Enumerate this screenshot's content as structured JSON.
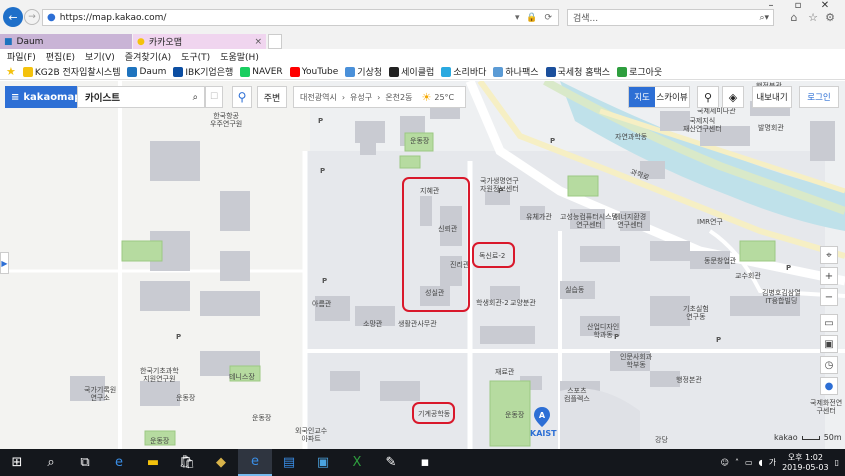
{
  "browser": {
    "url": "https://map.kakao.com/",
    "search_placeholder": "검색...",
    "tabs": [
      {
        "label": "Daum"
      },
      {
        "label": "카카오맵"
      }
    ],
    "menu": [
      "파일(F)",
      "편집(E)",
      "보기(V)",
      "즐겨찾기(A)",
      "도구(T)",
      "도움말(H)"
    ],
    "favorites": [
      {
        "label": "KG2B 전자입찰시스템",
        "color": "#f4c20d"
      },
      {
        "label": "Daum",
        "color": "#1e73be"
      },
      {
        "label": "IBK기업은행",
        "color": "#0c4ea2"
      },
      {
        "label": "NAVER",
        "color": "#19ce60"
      },
      {
        "label": "YouTube",
        "color": "#ff0000"
      },
      {
        "label": "기상청",
        "color": "#4a90d9"
      },
      {
        "label": "세이클럽",
        "color": "#222222"
      },
      {
        "label": "소리바다",
        "color": "#2aa9e0"
      },
      {
        "label": "하나팩스",
        "color": "#5b9bd5"
      },
      {
        "label": "국세청 홈택스",
        "color": "#1b4f9c"
      },
      {
        "label": "로그아웃",
        "color": "#2e9e3e"
      }
    ]
  },
  "map_ui": {
    "brand": "kakaomap",
    "search_value": "카이스트",
    "nearby_label": "주변",
    "breadcrumb": [
      "대전광역시",
      "유성구",
      "온천2동"
    ],
    "temperature": "25°C",
    "btn_map": "지도",
    "btn_skyview": "스카이뷰",
    "btn_export": "내보내기",
    "btn_login": "로그인",
    "scale_brand": "kakao",
    "scale": "50m"
  },
  "map_labels": [
    {
      "text": "한국항공\n우주연구원"
    },
    {
      "text": "운동장"
    },
    {
      "text": "지혜관"
    },
    {
      "text": "신뢰관"
    },
    {
      "text": "진리관"
    },
    {
      "text": "성실관"
    },
    {
      "text": "희망관"
    },
    {
      "text": "국가생명연구\n자원정보센터"
    },
    {
      "text": "유체가관"
    },
    {
      "text": "고성능컴퓨터시스템\n연구센터"
    },
    {
      "text": "에너지환경\n연구센터"
    },
    {
      "text": "IMR연구"
    },
    {
      "text": "동문창업관"
    },
    {
      "text": "교수회관"
    },
    {
      "text": "김병호김삼열\nIT융합빌딩"
    },
    {
      "text": "학생회관-2"
    },
    {
      "text": "교양분관"
    },
    {
      "text": "실습동"
    },
    {
      "text": "기초실험\n연구동"
    },
    {
      "text": "산업디자인\n학과동"
    },
    {
      "text": "인문사회과\n학부동"
    },
    {
      "text": "행정본관"
    },
    {
      "text": "스포츠\n컴플렉스"
    },
    {
      "text": "정보전자공학동"
    },
    {
      "text": "행정분관"
    },
    {
      "text": "자연과학동"
    },
    {
      "text": "국제지식\n재산연구센터"
    },
    {
      "text": "국제세미나관"
    },
    {
      "text": "발명회관"
    },
    {
      "text": "지식재산센터"
    },
    {
      "text": "아름관"
    },
    {
      "text": "소망관"
    },
    {
      "text": "생활관사무관"
    },
    {
      "text": "재료관"
    },
    {
      "text": "KAIST"
    },
    {
      "text": "국가기록원\n연구소"
    },
    {
      "text": "한국기초과학\n지원연구원"
    },
    {
      "text": "테니스장"
    },
    {
      "text": "운동장"
    },
    {
      "text": "운동장"
    },
    {
      "text": "운동장"
    },
    {
      "text": "운동장"
    },
    {
      "text": "외국인교수\n아파트"
    },
    {
      "text": "강당"
    },
    {
      "text": "궁동"
    },
    {
      "text": "동원정보관"
    },
    {
      "text": "과학로"
    },
    {
      "text": "갑천"
    },
    {
      "text": "국제화전연\n구센터"
    }
  ],
  "highlighted": [
    {
      "text": "독신료-2"
    },
    {
      "text": "기계공학동"
    }
  ],
  "taskbar": {
    "time": "오후 1:02",
    "date": "2019-05-03"
  }
}
